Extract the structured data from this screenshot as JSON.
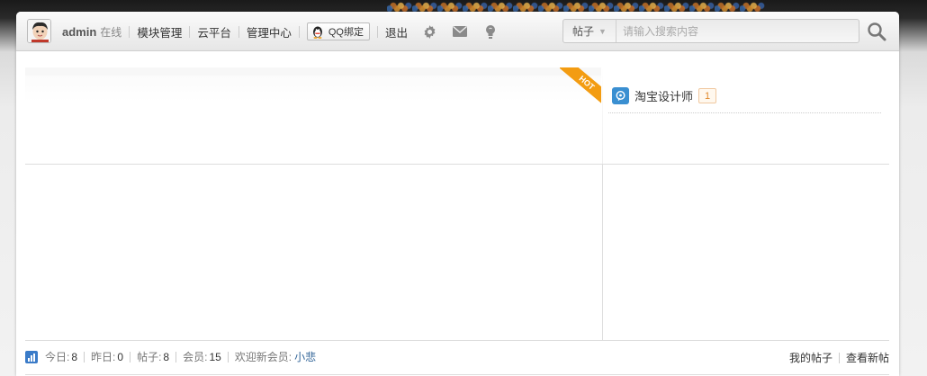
{
  "header": {
    "username": "admin",
    "status": "在线",
    "nav_items": [
      "模块管理",
      "云平台",
      "管理中心"
    ],
    "qq_bind_label": "QQ绑定",
    "logout_label": "退出",
    "icons": [
      "gear-icon",
      "mail-icon",
      "bulb-icon"
    ]
  },
  "search": {
    "scope_label": "帖子",
    "placeholder": "请输入搜索内容"
  },
  "hot": {
    "badge": "HOT"
  },
  "ranking": {
    "items": [
      {
        "name": "淘宝设计师",
        "count": "1"
      }
    ]
  },
  "stats": {
    "today_label": "今日:",
    "today_value": "8",
    "yesterday_label": "昨日:",
    "yesterday_value": "0",
    "posts_label": "帖子:",
    "posts_value": "8",
    "members_label": "会员:",
    "members_value": "15",
    "new_member_label": "欢迎新会员:",
    "new_member_name": "小悲"
  },
  "links": {
    "my_posts": "我的帖子",
    "new_posts": "查看新帖"
  },
  "colors": {
    "hot_badge": "#f39c12",
    "link_blue": "#336699",
    "count_orange": "#e08a2c"
  }
}
